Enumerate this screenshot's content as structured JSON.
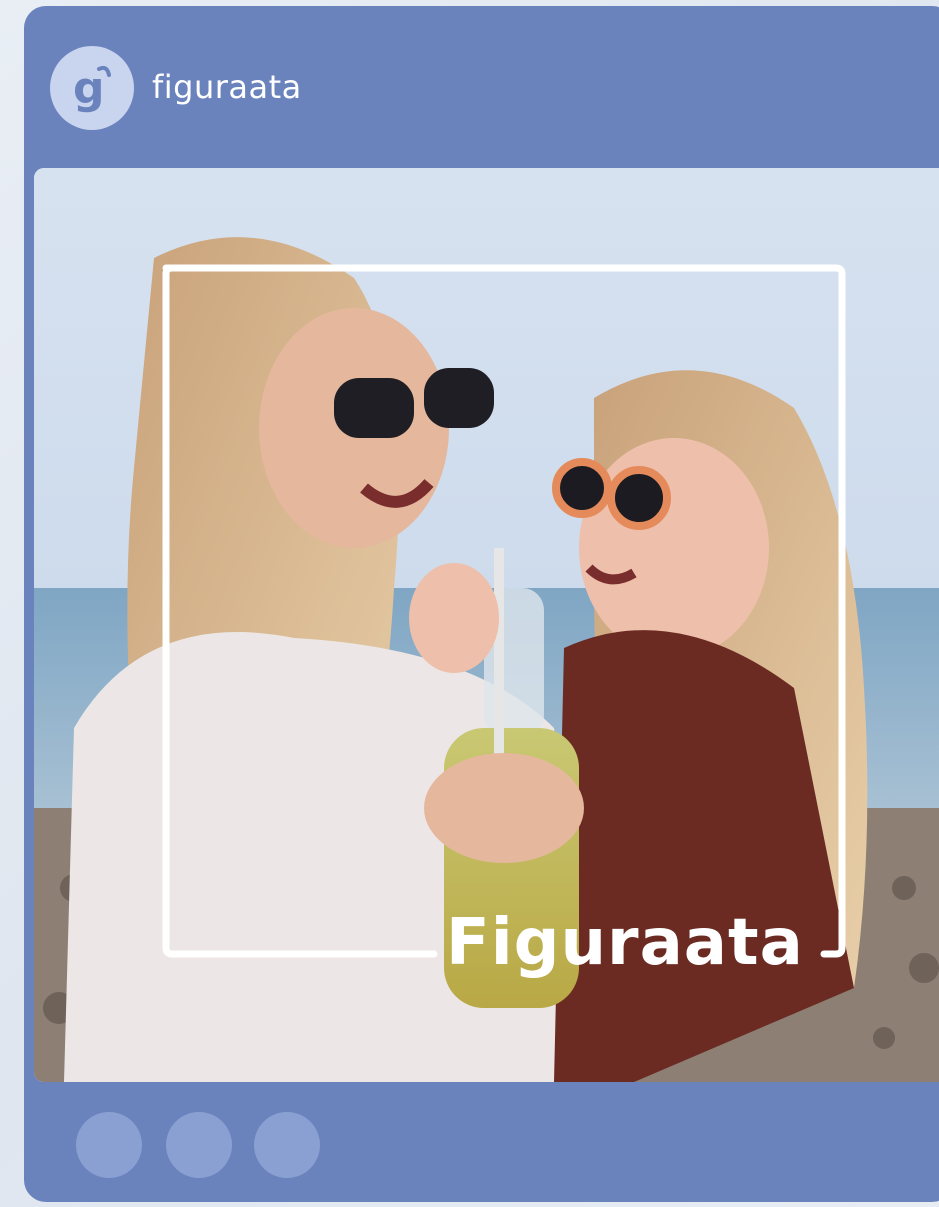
{
  "post": {
    "account": {
      "username": "figuraata",
      "avatar_icon": "figuraata-g-logo-icon"
    },
    "image": {
      "description_icon": "photo-mother-daughter-beach",
      "watermark_text": "Figuraata"
    },
    "footer": {
      "actions": [
        {
          "name": "action-dot-1"
        },
        {
          "name": "action-dot-2"
        },
        {
          "name": "action-dot-3"
        }
      ]
    }
  },
  "colors": {
    "card": "#6a83bd",
    "dots": "#8aa0d3",
    "avatar_bg": "#c9d4ee",
    "frame": "#ffffff"
  }
}
